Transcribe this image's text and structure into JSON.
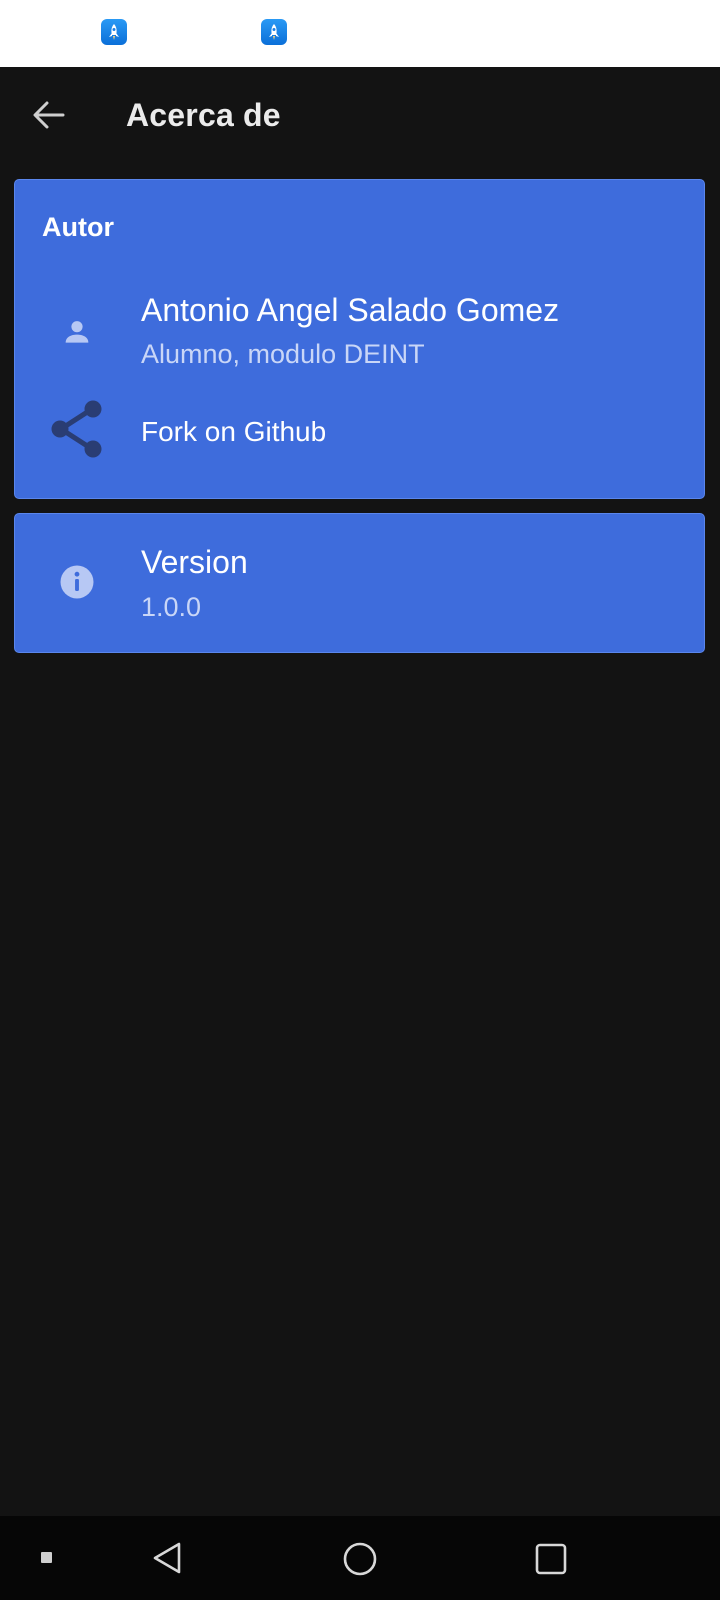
{
  "status_bar": {
    "icons": [
      "rocket-app-icon",
      "rocket-app-icon"
    ]
  },
  "app_bar": {
    "title": "Acerca de",
    "back_icon": "arrow-left-icon"
  },
  "author_section": {
    "header": "Autor",
    "author": {
      "icon": "person-icon",
      "name": "Antonio Angel Salado Gomez",
      "role": "Alumno, modulo DEINT"
    },
    "fork": {
      "icon": "share-icon",
      "label": "Fork on Github"
    }
  },
  "version_section": {
    "icon": "info-icon",
    "title": "Version",
    "value": "1.0.0"
  },
  "nav_bar": {
    "items": [
      "dot-icon",
      "back-triangle-icon",
      "home-circle-icon",
      "recents-square-icon"
    ]
  },
  "colors": {
    "background": "#131313",
    "card": "#3e6cdc",
    "card_border": "#5a86ec",
    "subtitle": "#c9d6f7",
    "icon_light": "#b7c8f4",
    "icon_dark": "#2a3d73"
  }
}
